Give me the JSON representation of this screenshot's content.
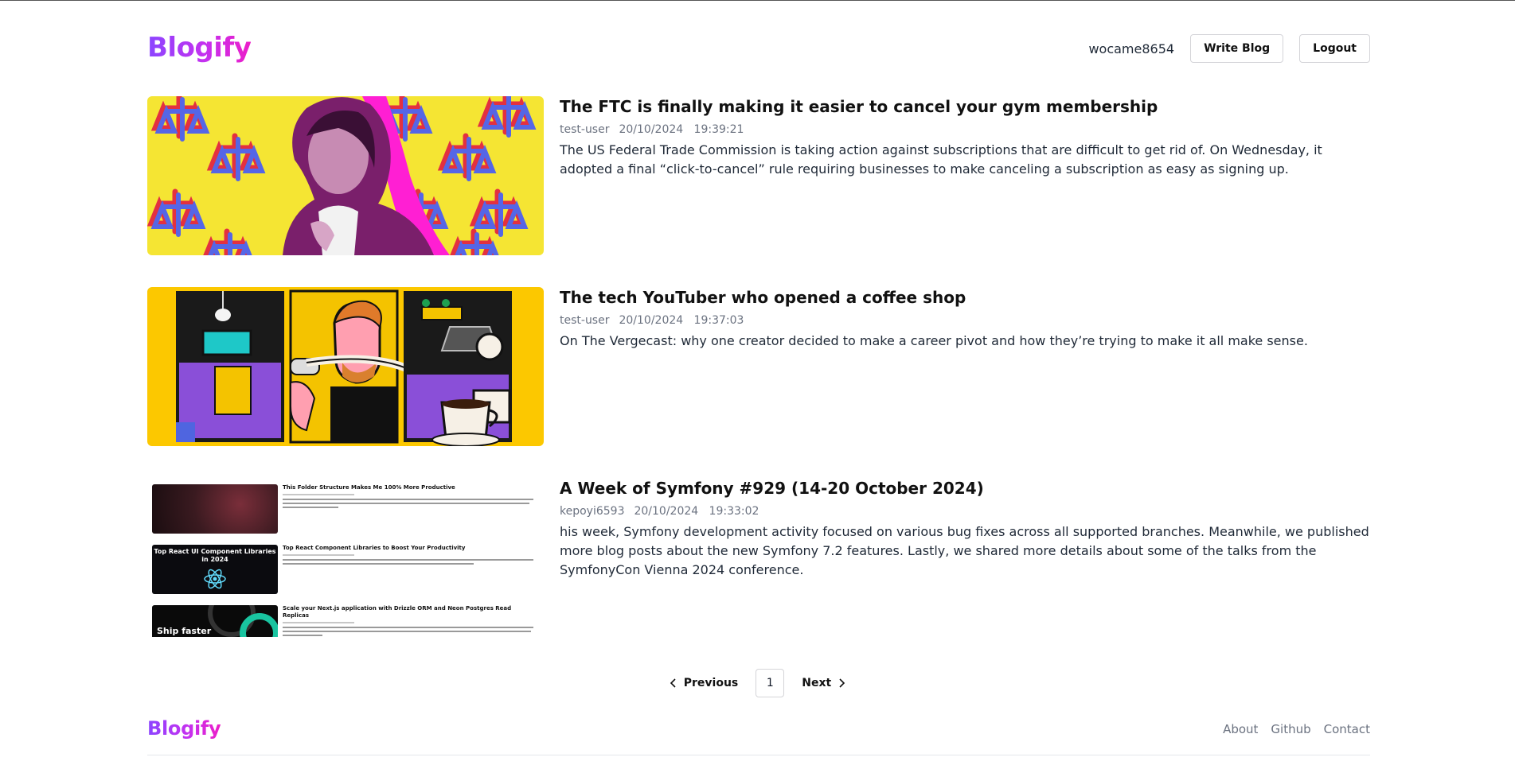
{
  "header": {
    "logo": "Blogify",
    "username": "wocame8654",
    "write_label": "Write Blog",
    "logout_label": "Logout"
  },
  "posts": [
    {
      "title": "The FTC is finally making it easier to cancel your gym membership",
      "author": "test-user",
      "date": "20/10/2024",
      "time": "19:39:21",
      "description": "The US Federal Trade Commission is taking action against subscriptions that are difficult to get rid of. On Wednesday, it adopted a final “click-to-cancel” rule requiring businesses to make canceling a subscription as easy as signing up."
    },
    {
      "title": "The tech YouTuber who opened a coffee shop",
      "author": "test-user",
      "date": "20/10/2024",
      "time": "19:37:03",
      "description": "On The Vergecast: why one creator decided to make a career pivot and how they’re trying to make it all make sense."
    },
    {
      "title": "A Week of Symfony #929 (14-20 October 2024)",
      "author": "kepoyi6593",
      "date": "20/10/2024",
      "time": "19:33:02",
      "description": "his week, Symfony development activity focused on various bug fixes across all supported branches. Meanwhile, we published more blog posts about the new Symfony 7.2 features. Lastly, we shared more details about some of the talks from the SymfonyCon Vienna 2024 conference.",
      "thumb_items": [
        {
          "title": "This Folder Structure Makes Me 100% More Productive"
        },
        {
          "title": "Top React Component Libraries to Boost Your Productivity",
          "image_text": "Top React UI Component Libraries in 2024"
        },
        {
          "title": "Scale your Next.js application with Drizzle ORM and Neon Postgres Read Replicas",
          "image_text": "Ship faster"
        }
      ]
    }
  ],
  "pagination": {
    "prev_label": "Previous",
    "current_page": "1",
    "next_label": "Next"
  },
  "footer": {
    "logo": "Blogify",
    "links": [
      "About",
      "Github",
      "Contact"
    ]
  },
  "colors": {
    "brand_start": "#8b45ff",
    "brand_end": "#ec1ec9",
    "thumb1_bg": "#f5e533",
    "thumb2_bg": "#fcc800"
  }
}
